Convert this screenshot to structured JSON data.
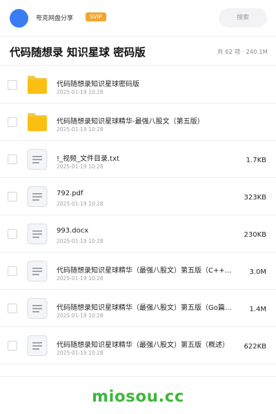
{
  "header": {
    "share_title": "夸克网盘分享",
    "badge": "SVIP",
    "search_placeholder": "搜索"
  },
  "folder": {
    "title": "代码随想录 知识星球 密码版",
    "meta": "共 62 项 · 240.1M"
  },
  "files": [
    {
      "type": "folder",
      "icon": "folder-icon",
      "name": "代码随想录知识星球密码版",
      "date": "2025-01-19 10:28",
      "size": ""
    },
    {
      "type": "folder",
      "icon": "folder-icon",
      "name": "代码随想录知识星球精华-最强八股文（第五版）",
      "date": "2025-01-19 10:28",
      "size": ""
    },
    {
      "type": "doc",
      "icon": "document-icon",
      "name": "!_视频_文件目录.txt",
      "date": "2025-01-19 10:28",
      "size": "1.7KB"
    },
    {
      "type": "doc",
      "icon": "document-icon",
      "name": "792.pdf",
      "date": "2025-01-19 10:28",
      "size": "323KB"
    },
    {
      "type": "doc",
      "icon": "document-icon",
      "name": "993.docx",
      "date": "2025-01-19 10:28",
      "size": "230KB"
    },
    {
      "type": "doc",
      "icon": "document-icon",
      "name": "代码随想录知识星球精华（最强八股文）第五版（C++…",
      "date": "2025-01-19 10:28",
      "size": "3.0M"
    },
    {
      "type": "doc",
      "icon": "document-icon",
      "name": "代码随想录知识星球精华（最强八股文）第五版（Go篇…",
      "date": "2025-01-19 10:28",
      "size": "1.4M"
    },
    {
      "type": "doc",
      "icon": "document-icon",
      "name": "代码随想录知识星球精华（最强八股文）第五版（概述）",
      "date": "2025-01-19 10:28",
      "size": "622KB"
    }
  ],
  "footer": {
    "brand": "miosou.cc"
  },
  "colors": {
    "avatar": "#3a7cf5",
    "badge": "#f2a62b",
    "folder": "#fbbf14",
    "brand": "#3cb73c"
  }
}
